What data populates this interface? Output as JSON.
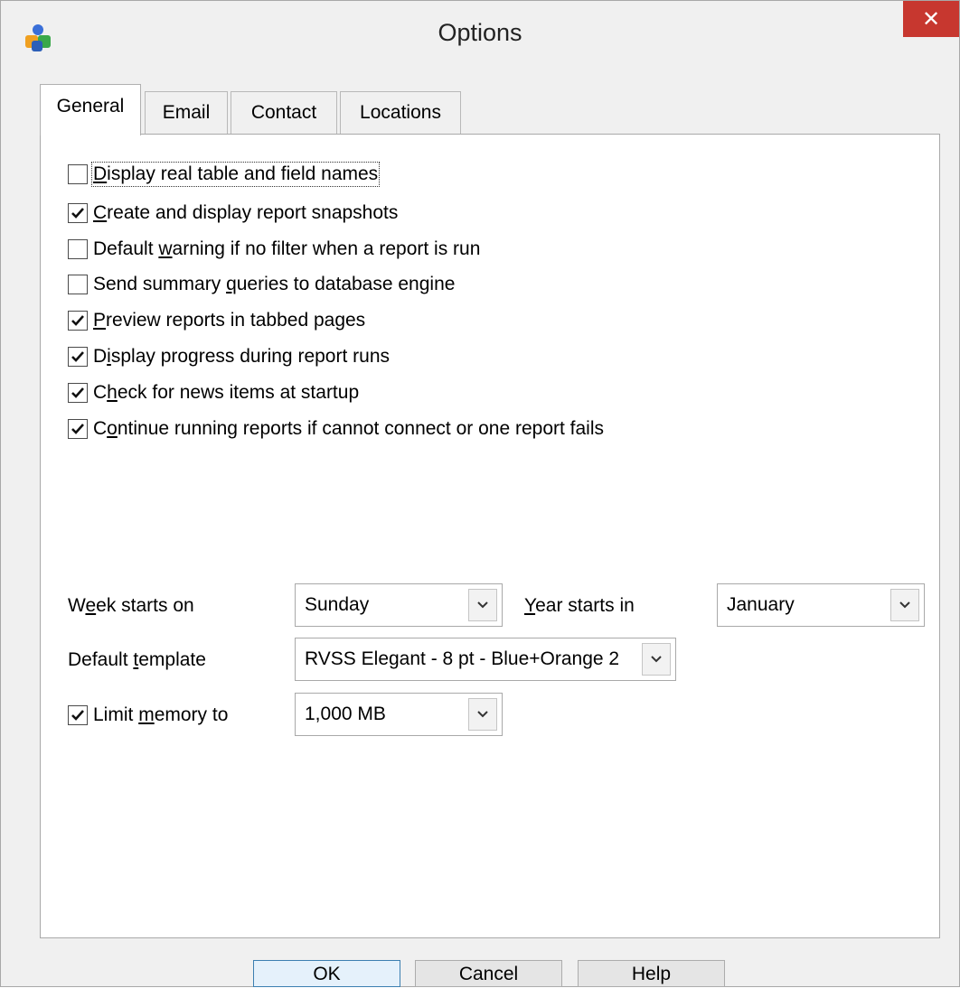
{
  "window": {
    "title": "Options",
    "close_glyph": "✕",
    "app_icon": "app-icon",
    "accent_close": "#c7372f"
  },
  "tabs": [
    {
      "label": "General",
      "active": true
    },
    {
      "label": "Email",
      "active": false
    },
    {
      "label": "Contact",
      "active": false
    },
    {
      "label": "Locations",
      "active": false
    }
  ],
  "options": [
    {
      "pre": "",
      "accel": "D",
      "post": "isplay real table and field names",
      "checked": false
    },
    {
      "pre": "",
      "accel": "C",
      "post": "reate and display report snapshots",
      "checked": true
    },
    {
      "pre": "Default ",
      "accel": "w",
      "post": "arning if no filter when a report is run",
      "checked": false
    },
    {
      "pre": "Send summary ",
      "accel": "q",
      "post": "ueries to database engine",
      "checked": false
    },
    {
      "pre": "",
      "accel": "P",
      "post": "review reports in tabbed pages",
      "checked": true
    },
    {
      "pre": "D",
      "accel": "i",
      "post": "splay progress during report runs",
      "checked": true
    },
    {
      "pre": "C",
      "accel": "h",
      "post": "eck for news items at startup",
      "checked": true
    },
    {
      "pre": "C",
      "accel": "o",
      "post": "ntinue running reports if cannot connect or one report fails",
      "checked": true
    }
  ],
  "week": {
    "label_pre": "W",
    "label_accel": "e",
    "label_post": "ek starts on",
    "value": "Sunday"
  },
  "year": {
    "label_pre": "",
    "label_accel": "Y",
    "label_post": "ear starts in",
    "value": "January"
  },
  "template": {
    "label_pre": "Default ",
    "label_accel": "t",
    "label_post": "emplate",
    "value": "RVSS Elegant - 8 pt - Blue+Orange 2"
  },
  "memory": {
    "label_pre": "Limit ",
    "label_accel": "m",
    "label_post": "emory to",
    "checked": true,
    "value": "1,000 MB"
  },
  "buttons": {
    "ok": "OK",
    "cancel": "Cancel",
    "help": "Help"
  }
}
